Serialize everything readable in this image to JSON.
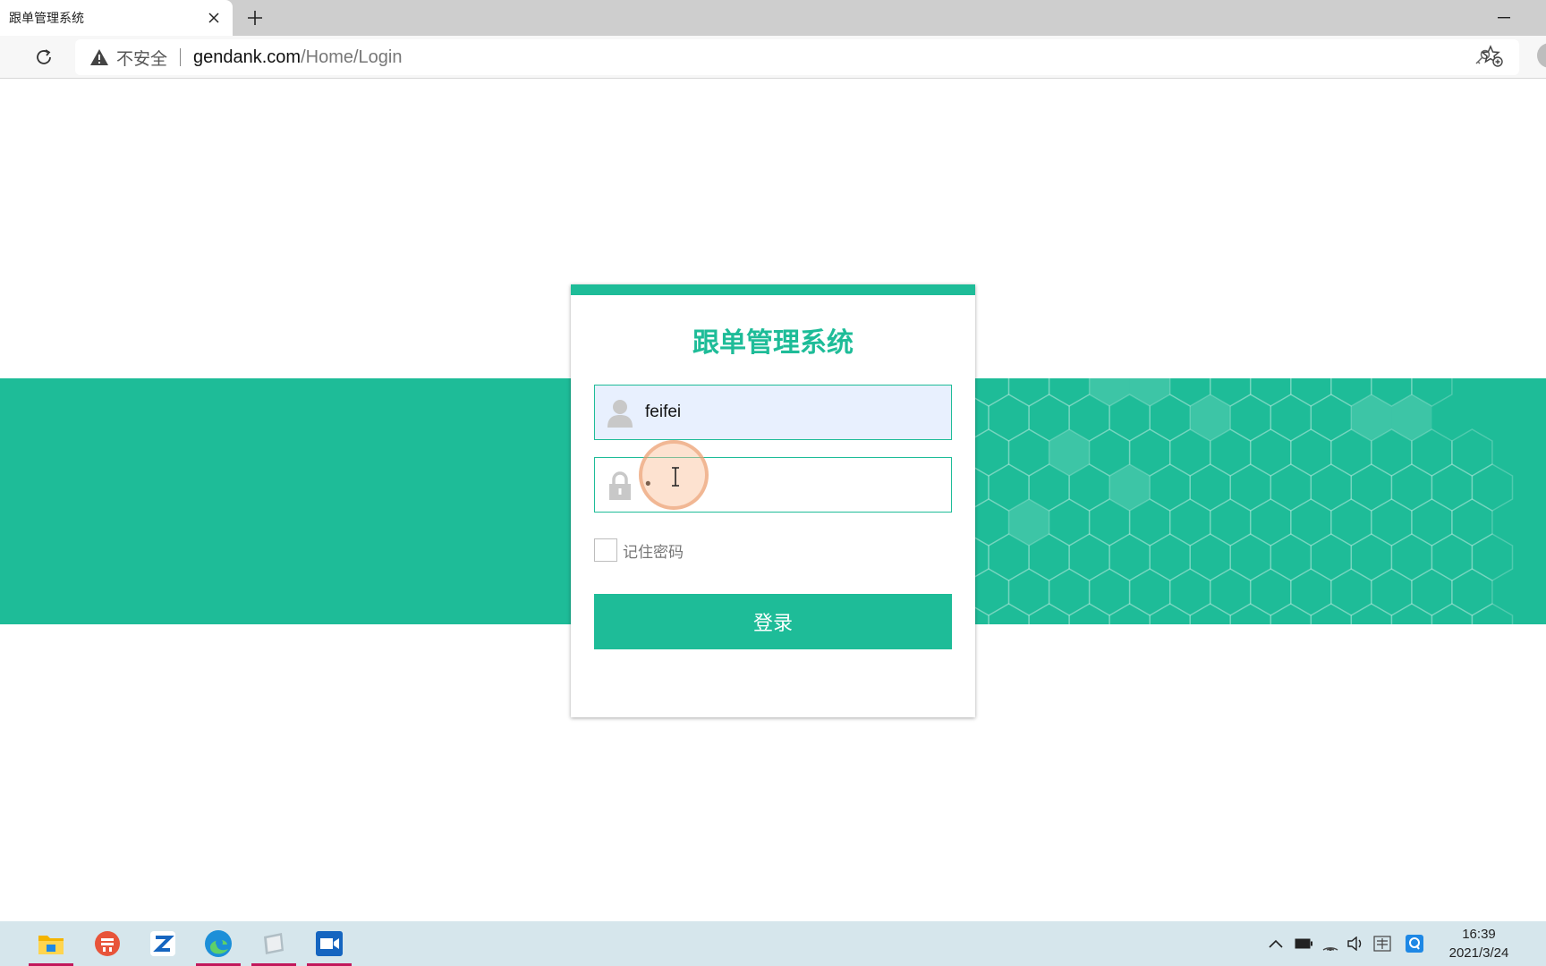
{
  "browser": {
    "tab_title": "跟单管理系统",
    "security_label": "不安全",
    "url_host": "gendank.com",
    "url_path": "/Home/Login"
  },
  "login": {
    "title": "跟单管理系统",
    "username_value": "feifei",
    "password_value": "•",
    "remember_label": "记住密码",
    "submit_label": "登录",
    "accent_color": "#1ebc98"
  },
  "taskbar": {
    "apps": [
      "file-explorer-icon",
      "app-orange-icon",
      "app-z-icon",
      "edge-icon",
      "notes-icon",
      "video-icon"
    ],
    "clock_time": "16:39",
    "clock_date": "2021/3/24"
  }
}
